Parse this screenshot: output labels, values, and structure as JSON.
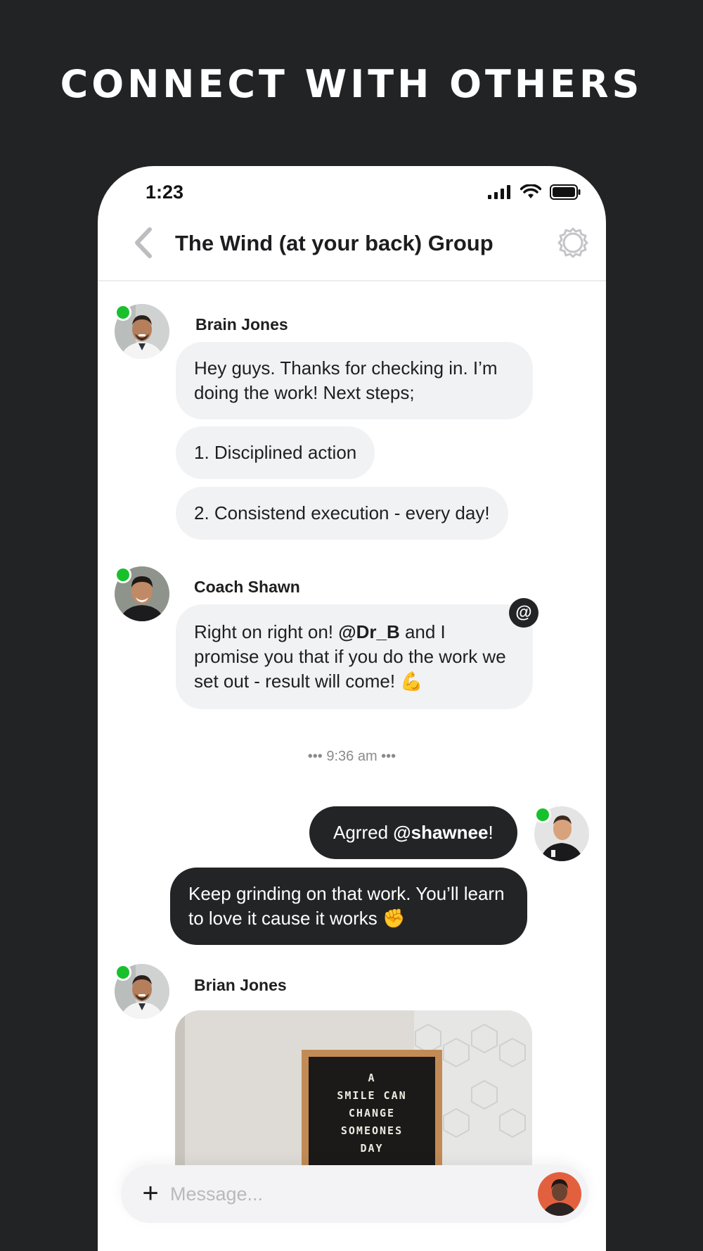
{
  "headline": "CONNECT WITH OTHERS",
  "status": {
    "time": "1:23"
  },
  "header": {
    "title": "The Wind (at your back) Group"
  },
  "messages": {
    "group1": {
      "sender": "Brain Jones",
      "bubble1": "Hey guys. Thanks for checking in. I’m doing the work! Next steps;",
      "bubble2": "1. Disciplined action",
      "bubble3": "2. Consistend execution - every day!"
    },
    "group2": {
      "sender": "Coach Shawn",
      "text_before": "Right on right on! ",
      "mention": "@Dr_B",
      "text_after": " and I promise you that if you do the work we set out - result will come! 💪",
      "badge": "@"
    },
    "time_separator": "••• 9:36 am •••",
    "group3": {
      "bubble1_before": "Agrred ",
      "bubble1_mention": "@shawnee",
      "bubble1_after": "!",
      "bubble2": "Keep grinding on that work. You’ll learn to love it cause it works ✊"
    },
    "group4": {
      "sender": "Brian Jones",
      "image_text": [
        "A",
        "SMILE CAN",
        "CHANGE",
        "SOMEONES",
        "DAY"
      ]
    }
  },
  "composer": {
    "placeholder": "Message...",
    "plus": "+"
  },
  "colors": {
    "background": "#222325",
    "bubble_light": "#f1f2f4",
    "bubble_dark": "#232426",
    "online": "#18c12c"
  }
}
